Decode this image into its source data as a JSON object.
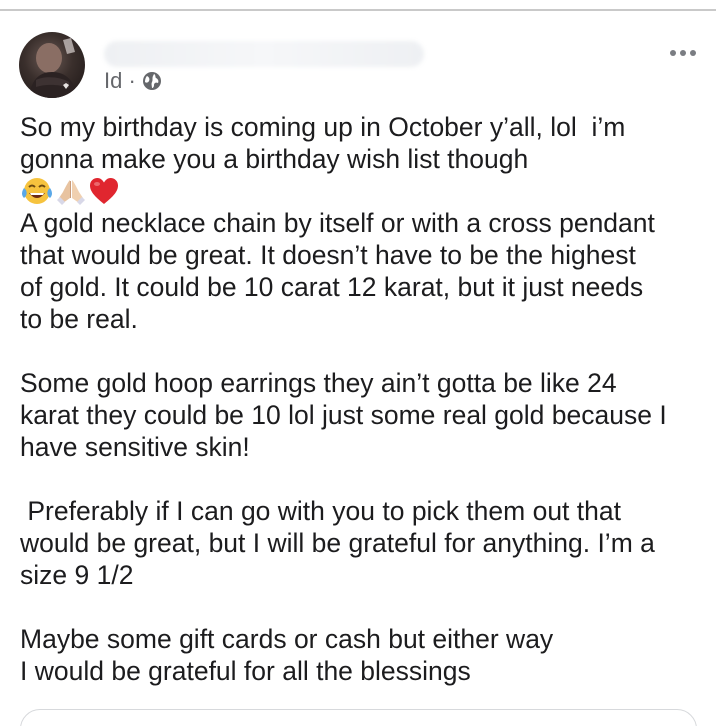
{
  "post": {
    "author": {
      "avatar_icon": "profile-photo",
      "name_redacted": true
    },
    "timestamp": "Id ·",
    "audience_icon": "globe-icon",
    "more_icon": "more-horizontal-icon",
    "paragraphs": [
      {
        "lines": [
          "So my birthday is coming up in October y’all, lol  i’m",
          "gonna make you a birthday wish list though"
        ],
        "emojis": [
          "face-with-tears-of-joy-emoji",
          "folded-hands-emoji",
          "red-heart-emoji"
        ]
      },
      {
        "lines": [
          "A gold necklace chain by itself or with a cross pendant",
          "that would be great. It doesn’t have to be the highest",
          "of gold. It could be 10 carat 12 karat, but it just needs",
          "to be real."
        ]
      },
      {
        "lines": [
          "Some gold hoop earrings they ain’t gotta be like 24",
          "karat they could be 10 lol just some real gold because I",
          "have sensitive skin!"
        ]
      },
      {
        "lines": [
          " Preferably if I can go with you to pick them out that",
          "would be great, but I will be grateful for anything. I’m a",
          "size 9 1/2"
        ]
      },
      {
        "lines": [
          "Maybe some gift cards or cash but either way",
          "I would be grateful for all the blessings"
        ]
      }
    ]
  },
  "colors": {
    "text": "#1c1c1e",
    "meta_text": "#65676b",
    "border": "#c9c9c9"
  }
}
